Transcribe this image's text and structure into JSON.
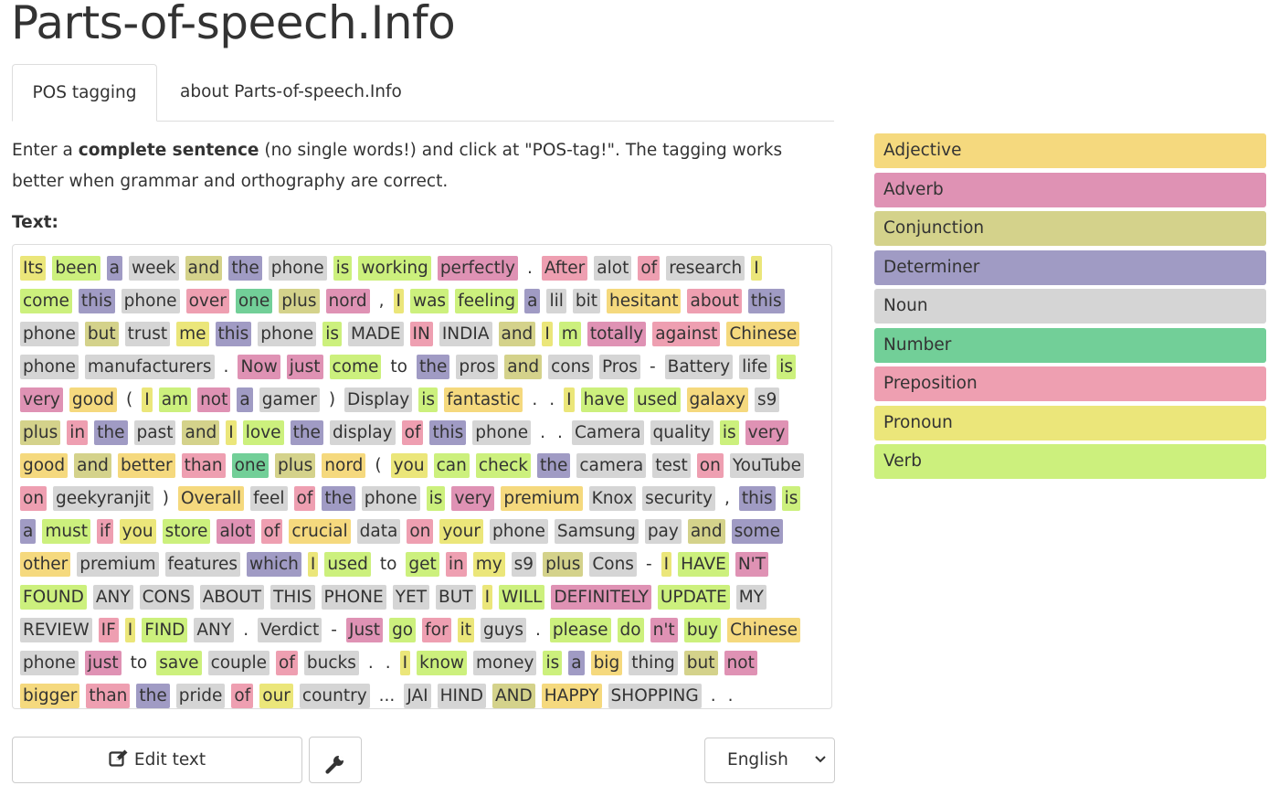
{
  "site": {
    "title": "Parts-of-speech.Info"
  },
  "tabs": [
    {
      "label": "POS tagging",
      "active": true
    },
    {
      "label": "about Parts-of-speech.Info",
      "active": false
    }
  ],
  "intro": {
    "part1": "Enter a ",
    "bold": "complete sentence",
    "part2": " (no single words!) and click at \"POS-tag!\". The tagging works better when grammar and orthography are correct."
  },
  "text_label": "Text:",
  "tokens": [
    [
      "Its",
      "pronoun"
    ],
    [
      "been",
      "verb"
    ],
    [
      "a",
      "determiner"
    ],
    [
      "week",
      "noun"
    ],
    [
      "and",
      "conjunction"
    ],
    [
      "the",
      "determiner"
    ],
    [
      "phone",
      "noun"
    ],
    [
      "is",
      "verb"
    ],
    [
      "working",
      "verb"
    ],
    [
      "perfectly",
      "adverb"
    ],
    [
      ".",
      "plain"
    ],
    [
      "After",
      "preposition"
    ],
    [
      "alot",
      "noun"
    ],
    [
      "of",
      "preposition"
    ],
    [
      "research",
      "noun"
    ],
    [
      "I",
      "pronoun"
    ],
    [
      "come",
      "verb"
    ],
    [
      "this",
      "determiner"
    ],
    [
      "phone",
      "noun"
    ],
    [
      "over",
      "preposition"
    ],
    [
      "one",
      "number"
    ],
    [
      "plus",
      "conjunction"
    ],
    [
      "nord",
      "adverb"
    ],
    [
      ",",
      "plain"
    ],
    [
      "I",
      "pronoun"
    ],
    [
      "was",
      "verb"
    ],
    [
      "feeling",
      "verb"
    ],
    [
      "a",
      "determiner"
    ],
    [
      "lil",
      "noun"
    ],
    [
      "bit",
      "noun"
    ],
    [
      "hesitant",
      "adjective"
    ],
    [
      "about",
      "preposition"
    ],
    [
      "this",
      "determiner"
    ],
    [
      "phone",
      "noun"
    ],
    [
      "but",
      "conjunction"
    ],
    [
      "trust",
      "noun"
    ],
    [
      "me",
      "pronoun"
    ],
    [
      "this",
      "determiner"
    ],
    [
      "phone",
      "noun"
    ],
    [
      "is",
      "verb"
    ],
    [
      "MADE",
      "noun"
    ],
    [
      "IN",
      "preposition"
    ],
    [
      "INDIA",
      "noun"
    ],
    [
      "and",
      "conjunction"
    ],
    [
      "I",
      "pronoun"
    ],
    [
      "m",
      "verb"
    ],
    [
      "totally",
      "adverb"
    ],
    [
      "against",
      "preposition"
    ],
    [
      "Chinese",
      "adjective"
    ],
    [
      "phone",
      "noun"
    ],
    [
      "manufacturers",
      "noun"
    ],
    [
      ".",
      "plain"
    ],
    [
      "Now",
      "adverb"
    ],
    [
      "just",
      "adverb"
    ],
    [
      "come",
      "verb"
    ],
    [
      "to",
      "plain"
    ],
    [
      "the",
      "determiner"
    ],
    [
      "pros",
      "noun"
    ],
    [
      "and",
      "conjunction"
    ],
    [
      "cons",
      "noun"
    ],
    [
      "Pros",
      "noun"
    ],
    [
      "-",
      "plain"
    ],
    [
      "Battery",
      "noun"
    ],
    [
      "life",
      "noun"
    ],
    [
      "is",
      "verb"
    ],
    [
      "very",
      "adverb"
    ],
    [
      "good",
      "adjective"
    ],
    [
      "(",
      "plain"
    ],
    [
      "I",
      "pronoun"
    ],
    [
      "am",
      "verb"
    ],
    [
      "not",
      "adverb"
    ],
    [
      "a",
      "determiner"
    ],
    [
      "gamer",
      "noun"
    ],
    [
      ")",
      "plain"
    ],
    [
      "Display",
      "noun"
    ],
    [
      "is",
      "verb"
    ],
    [
      "fantastic",
      "adjective"
    ],
    [
      ".",
      "plain"
    ],
    [
      ".",
      "plain"
    ],
    [
      "I",
      "pronoun"
    ],
    [
      "have",
      "verb"
    ],
    [
      "used",
      "verb"
    ],
    [
      "galaxy",
      "adjective"
    ],
    [
      "s9",
      "noun"
    ],
    [
      "plus",
      "conjunction"
    ],
    [
      "in",
      "preposition"
    ],
    [
      "the",
      "determiner"
    ],
    [
      "past",
      "noun"
    ],
    [
      "and",
      "conjunction"
    ],
    [
      "I",
      "pronoun"
    ],
    [
      "love",
      "verb"
    ],
    [
      "the",
      "determiner"
    ],
    [
      "display",
      "noun"
    ],
    [
      "of",
      "preposition"
    ],
    [
      "this",
      "determiner"
    ],
    [
      "phone",
      "noun"
    ],
    [
      ".",
      "plain"
    ],
    [
      ".",
      "plain"
    ],
    [
      "Camera",
      "noun"
    ],
    [
      "quality",
      "noun"
    ],
    [
      "is",
      "verb"
    ],
    [
      "very",
      "adverb"
    ],
    [
      "good",
      "adjective"
    ],
    [
      "and",
      "conjunction"
    ],
    [
      "better",
      "adjective"
    ],
    [
      "than",
      "preposition"
    ],
    [
      "one",
      "number"
    ],
    [
      "plus",
      "conjunction"
    ],
    [
      "nord",
      "adjective"
    ],
    [
      "(",
      "plain"
    ],
    [
      "you",
      "pronoun"
    ],
    [
      "can",
      "verb"
    ],
    [
      "check",
      "verb"
    ],
    [
      "the",
      "determiner"
    ],
    [
      "camera",
      "noun"
    ],
    [
      "test",
      "noun"
    ],
    [
      "on",
      "preposition"
    ],
    [
      "YouTube",
      "noun"
    ],
    [
      "on",
      "preposition"
    ],
    [
      "geekyranjit",
      "noun"
    ],
    [
      ")",
      "plain"
    ],
    [
      "Overall",
      "adjective"
    ],
    [
      "feel",
      "noun"
    ],
    [
      "of",
      "preposition"
    ],
    [
      "the",
      "determiner"
    ],
    [
      "phone",
      "noun"
    ],
    [
      "is",
      "verb"
    ],
    [
      "very",
      "adverb"
    ],
    [
      "premium",
      "adjective"
    ],
    [
      "Knox",
      "noun"
    ],
    [
      "security",
      "noun"
    ],
    [
      ",",
      "plain"
    ],
    [
      "this",
      "determiner"
    ],
    [
      "is",
      "verb"
    ],
    [
      "a",
      "determiner"
    ],
    [
      "must",
      "verb"
    ],
    [
      "if",
      "preposition"
    ],
    [
      "you",
      "pronoun"
    ],
    [
      "store",
      "verb"
    ],
    [
      "alot",
      "adverb"
    ],
    [
      "of",
      "preposition"
    ],
    [
      "crucial",
      "adjective"
    ],
    [
      "data",
      "noun"
    ],
    [
      "on",
      "preposition"
    ],
    [
      "your",
      "pronoun"
    ],
    [
      "phone",
      "noun"
    ],
    [
      "Samsung",
      "noun"
    ],
    [
      "pay",
      "noun"
    ],
    [
      "and",
      "conjunction"
    ],
    [
      "some",
      "determiner"
    ],
    [
      "other",
      "adjective"
    ],
    [
      "premium",
      "noun"
    ],
    [
      "features",
      "noun"
    ],
    [
      "which",
      "determiner"
    ],
    [
      "I",
      "pronoun"
    ],
    [
      "used",
      "verb"
    ],
    [
      "to",
      "plain"
    ],
    [
      "get",
      "verb"
    ],
    [
      "in",
      "preposition"
    ],
    [
      "my",
      "pronoun"
    ],
    [
      "s9",
      "noun"
    ],
    [
      "plus",
      "conjunction"
    ],
    [
      "Cons",
      "noun"
    ],
    [
      "-",
      "plain"
    ],
    [
      "I",
      "pronoun"
    ],
    [
      "HAVE",
      "verb"
    ],
    [
      "N'T",
      "adverb"
    ],
    [
      "FOUND",
      "verb"
    ],
    [
      "ANY",
      "noun"
    ],
    [
      "CONS",
      "noun"
    ],
    [
      "ABOUT",
      "noun"
    ],
    [
      "THIS",
      "noun"
    ],
    [
      "PHONE",
      "noun"
    ],
    [
      "YET",
      "noun"
    ],
    [
      "BUT",
      "noun"
    ],
    [
      "I",
      "pronoun"
    ],
    [
      "WILL",
      "verb"
    ],
    [
      "DEFINITELY",
      "adverb"
    ],
    [
      "UPDATE",
      "verb"
    ],
    [
      "MY",
      "noun"
    ],
    [
      "REVIEW",
      "noun"
    ],
    [
      "IF",
      "preposition"
    ],
    [
      "I",
      "pronoun"
    ],
    [
      "FIND",
      "verb"
    ],
    [
      "ANY",
      "noun"
    ],
    [
      ".",
      "plain"
    ],
    [
      "Verdict",
      "noun"
    ],
    [
      "-",
      "plain"
    ],
    [
      "Just",
      "adverb"
    ],
    [
      "go",
      "verb"
    ],
    [
      "for",
      "preposition"
    ],
    [
      "it",
      "pronoun"
    ],
    [
      "guys",
      "noun"
    ],
    [
      ".",
      "plain"
    ],
    [
      "please",
      "verb"
    ],
    [
      "do",
      "verb"
    ],
    [
      "n't",
      "adverb"
    ],
    [
      "buy",
      "verb"
    ],
    [
      "Chinese",
      "adjective"
    ],
    [
      "phone",
      "noun"
    ],
    [
      "just",
      "adverb"
    ],
    [
      "to",
      "plain"
    ],
    [
      "save",
      "verb"
    ],
    [
      "couple",
      "noun"
    ],
    [
      "of",
      "preposition"
    ],
    [
      "bucks",
      "noun"
    ],
    [
      ".",
      "plain"
    ],
    [
      ".",
      "plain"
    ],
    [
      "I",
      "pronoun"
    ],
    [
      "know",
      "verb"
    ],
    [
      "money",
      "noun"
    ],
    [
      "is",
      "verb"
    ],
    [
      "a",
      "determiner"
    ],
    [
      "big",
      "adjective"
    ],
    [
      "thing",
      "noun"
    ],
    [
      "but",
      "conjunction"
    ],
    [
      "not",
      "adverb"
    ],
    [
      "bigger",
      "adjective"
    ],
    [
      "than",
      "preposition"
    ],
    [
      "the",
      "determiner"
    ],
    [
      "pride",
      "noun"
    ],
    [
      "of",
      "preposition"
    ],
    [
      "our",
      "pronoun"
    ],
    [
      "country",
      "noun"
    ],
    [
      "...",
      "plain"
    ],
    [
      "JAI",
      "noun"
    ],
    [
      "HIND",
      "noun"
    ],
    [
      "AND",
      "conjunction"
    ],
    [
      "HAPPY",
      "adjective"
    ],
    [
      "SHOPPING",
      "noun"
    ],
    [
      ".",
      "plain"
    ],
    [
      ".",
      "plain"
    ]
  ],
  "legend": [
    {
      "label": "Adjective",
      "cls": "adjective",
      "color": "#f5d97e"
    },
    {
      "label": "Adverb",
      "cls": "adverb",
      "color": "#df92b4"
    },
    {
      "label": "Conjunction",
      "cls": "conjunction",
      "color": "#d4d28b"
    },
    {
      "label": "Determiner",
      "cls": "determiner",
      "color": "#a09bc4"
    },
    {
      "label": "Noun",
      "cls": "noun",
      "color": "#d5d5d5"
    },
    {
      "label": "Number",
      "cls": "number",
      "color": "#72cf98"
    },
    {
      "label": "Preposition",
      "cls": "preposition",
      "color": "#ee9fb1"
    },
    {
      "label": "Pronoun",
      "cls": "pronoun",
      "color": "#ebe67a"
    },
    {
      "label": "Verb",
      "cls": "verb",
      "color": "#ccf07d"
    }
  ],
  "buttons": {
    "edit_text_label": "Edit text",
    "edit_icon": "edit-icon",
    "tools_icon": "wrench-icon"
  },
  "language_select": {
    "selected": "English"
  }
}
